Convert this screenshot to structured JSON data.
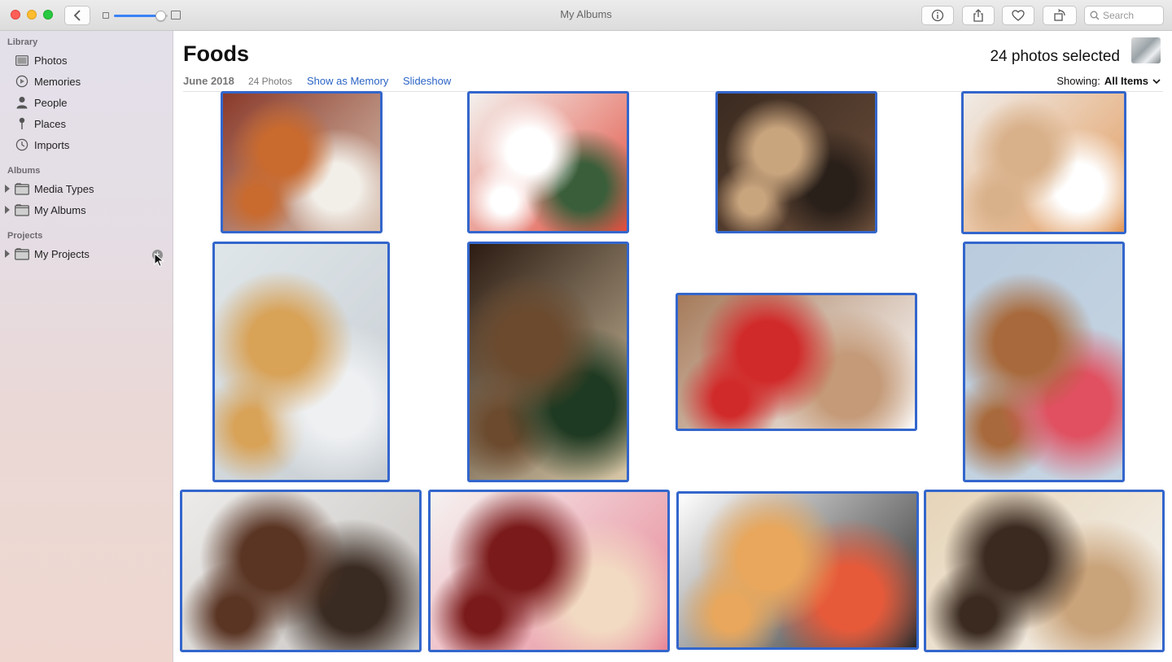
{
  "window": {
    "title": "My Albums"
  },
  "toolbar": {
    "search_placeholder": "Search",
    "zoom_level": 0.86
  },
  "sidebar": {
    "sections": [
      {
        "header": "Library",
        "items": [
          {
            "label": "Photos",
            "icon": "photos-icon"
          },
          {
            "label": "Memories",
            "icon": "memories-icon"
          },
          {
            "label": "People",
            "icon": "people-icon"
          },
          {
            "label": "Places",
            "icon": "places-icon"
          },
          {
            "label": "Imports",
            "icon": "imports-icon"
          }
        ]
      },
      {
        "header": "Albums",
        "items": [
          {
            "label": "Media Types",
            "icon": "folder-icon"
          },
          {
            "label": "My Albums",
            "icon": "folder-icon"
          }
        ]
      },
      {
        "header": "Projects",
        "items": [
          {
            "label": "My Projects",
            "icon": "folder-icon"
          }
        ]
      }
    ],
    "add_glyph": "+"
  },
  "album": {
    "title": "Foods",
    "date": "June 2018",
    "photo_count": "24 Photos",
    "show_memory": "Show as Memory",
    "slideshow": "Slideshow",
    "selected": "24 photos selected",
    "showing_label": "Showing:",
    "showing_value": "All Items"
  },
  "photos": [
    {
      "name": "french-toast-strawberries",
      "colors": [
        "#8a3a2a",
        "#d9c3b2",
        "#c96a2e",
        "#f2efe9"
      ]
    },
    {
      "name": "strawberry-yogurt-jars",
      "colors": [
        "#f4f1ee",
        "#e14b3c",
        "#ffffff",
        "#3b5e3a"
      ]
    },
    {
      "name": "latte-art-pastry",
      "colors": [
        "#3a2a20",
        "#6b4e3a",
        "#c9a57e",
        "#2a201a"
      ]
    },
    {
      "name": "orange-macarons",
      "colors": [
        "#f0ece8",
        "#e29a5c",
        "#d8b089",
        "#ffffff"
      ]
    },
    {
      "name": "pancake-stack-honey",
      "colors": [
        "#dfe6ea",
        "#c7cdd2",
        "#d8a257",
        "#eef0f2"
      ]
    },
    {
      "name": "lemon-cake-plate",
      "colors": [
        "#2b1b12",
        "#d9c9a8",
        "#6b4a2e",
        "#1f3a22"
      ]
    },
    {
      "name": "raspberries-in-cup",
      "colors": [
        "#a57a5a",
        "#ffffff",
        "#d12a2a",
        "#c49a78"
      ]
    },
    {
      "name": "freakshake-popcorn",
      "colors": [
        "#b9cbdd",
        "#c8d6e3",
        "#a86a3c",
        "#e05060"
      ]
    },
    {
      "name": "cookies-cooling-rack",
      "colors": [
        "#ecebe9",
        "#c8c5c2",
        "#5a3524",
        "#3a2b22"
      ]
    },
    {
      "name": "strawberry-popsicles",
      "colors": [
        "#f5f2f1",
        "#e88797",
        "#7a1a1a",
        "#f2d9c2"
      ]
    },
    {
      "name": "donuts-and-candy",
      "colors": [
        "#ffffff",
        "#2a2a2a",
        "#e8a75c",
        "#e65a3a"
      ]
    },
    {
      "name": "ice-cream-bars-tray",
      "colors": [
        "#e6d4b8",
        "#f5f3ef",
        "#3a2a20",
        "#c9a37a"
      ]
    }
  ]
}
